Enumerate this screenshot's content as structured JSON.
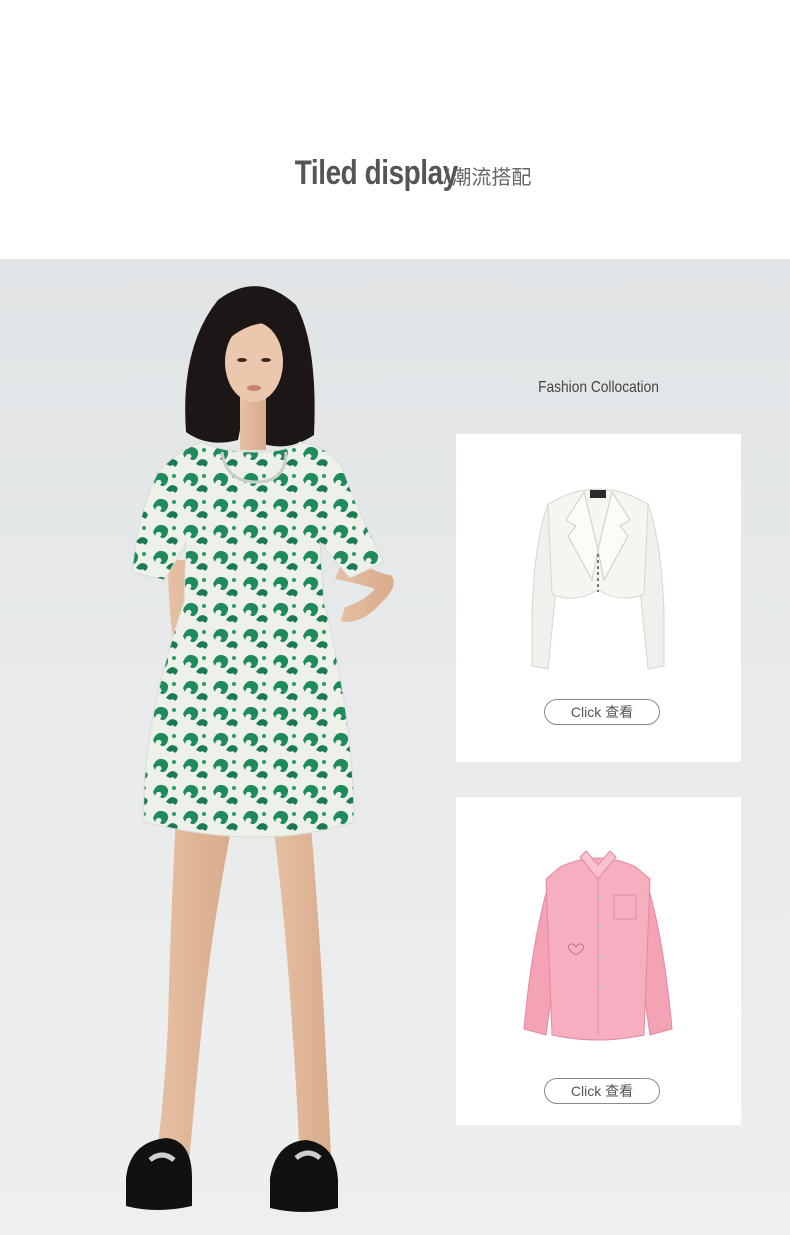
{
  "header": {
    "title": "Tiled display",
    "separator": "/",
    "subtitle": "潮流搭配"
  },
  "side_heading": "Fashion Collocation",
  "products": [
    {
      "name": "white cropped blazer",
      "button_label": "Click 查看"
    },
    {
      "name": "pink denim shirt",
      "button_label": "Click 查看"
    }
  ],
  "colors": {
    "dress_green": "#1f8a5e",
    "dress_cream": "#eef1ea",
    "blazer_white": "#f4f3ef",
    "shirt_pink": "#f4a3b6",
    "backdrop": "#e6e8e9"
  }
}
